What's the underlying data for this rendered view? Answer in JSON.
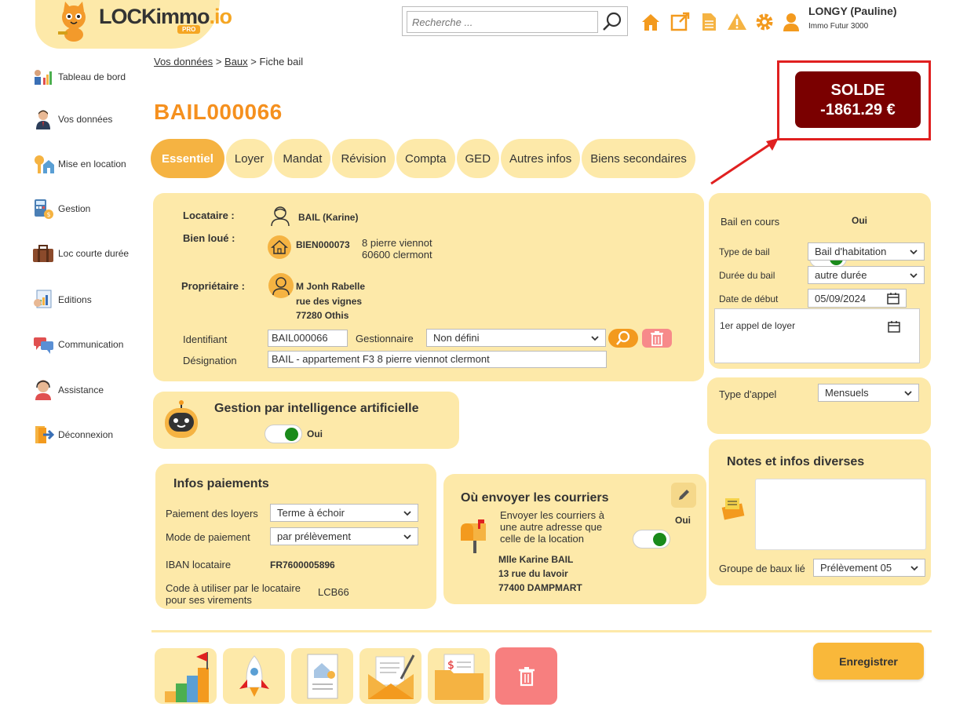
{
  "logo": {
    "name_main": "LOCKimmo",
    "name_suffix": ".io",
    "badge": "PRO"
  },
  "search": {
    "placeholder": "Recherche ..."
  },
  "user": {
    "name": "LONGY (Pauline)",
    "company": "Immo Futur 3000"
  },
  "sidebar": {
    "items": [
      {
        "label": "Tableau de bord"
      },
      {
        "label": "Vos données"
      },
      {
        "label": "Mise en location"
      },
      {
        "label": "Gestion"
      },
      {
        "label": "Loc courte durée"
      },
      {
        "label": "Editions"
      },
      {
        "label": "Communication"
      },
      {
        "label": "Assistance"
      },
      {
        "label": "Déconnexion"
      }
    ]
  },
  "breadcrumb": {
    "item1": "Vos données",
    "item2": "Baux",
    "current": "Fiche bail",
    "sep": ">"
  },
  "page": {
    "title": "BAIL000066"
  },
  "solde": {
    "label": "SOLDE",
    "amount": "-1861.29 €"
  },
  "tabs": [
    "Essentiel",
    "Loyer",
    "Mandat",
    "Révision",
    "Compta",
    "GED",
    "Autres infos",
    "Biens secondaires"
  ],
  "main": {
    "locataire_label": "Locataire :",
    "locataire_value": "BAIL (Karine)",
    "bien_label": "Bien loué :",
    "bien_ref": "BIEN000073",
    "bien_addr1": "8 pierre viennot",
    "bien_addr2": "60600 clermont",
    "proprio_label": "Propriétaire :",
    "proprio_name": "M Jonh Rabelle",
    "proprio_addr1": "rue des vignes",
    "proprio_addr2": "77280 Othis",
    "identifiant_label": "Identifiant",
    "identifiant_value": "BAIL000066",
    "gestionnaire_label": "Gestionnaire",
    "gestionnaire_value": "Non défini",
    "designation_label": "Désignation",
    "designation_value": "BAIL - appartement F3 8 pierre viennot clermont"
  },
  "ai": {
    "title": "Gestion par intelligence artificielle",
    "toggle_label": "Oui"
  },
  "paiements": {
    "title": "Infos paiements",
    "paiement_label": "Paiement des loyers",
    "paiement_value": "Terme à échoir",
    "mode_label": "Mode de paiement",
    "mode_value": "par prélèvement",
    "iban_label": "IBAN locataire",
    "iban_value": "FR7600005896",
    "code_label_1": "Code à utiliser par le locataire",
    "code_label_2": "pour ses virements",
    "code_value": "LCB66"
  },
  "courriers": {
    "title": "Où envoyer les courriers",
    "desc_1": "Envoyer les courriers à",
    "desc_2": "une autre adresse que",
    "desc_3": "celle de la location",
    "toggle_label": "Oui",
    "addr_name": "Mlle Karine BAIL",
    "addr_1": "13 rue du lavoir",
    "addr_2": "77400 DAMPMART"
  },
  "bail": {
    "en_cours_label": "Bail en cours",
    "en_cours_toggle": "Oui",
    "type_label": "Type de bail",
    "type_value": "Bail d'habitation",
    "duree_label": "Durée du bail",
    "duree_value": "autre durée",
    "debut_label": "Date de début",
    "debut_value": "05/09/2024",
    "appel_label": "1er appel de loyer"
  },
  "appel": {
    "label": "Type d'appel",
    "value": "Mensuels"
  },
  "notes": {
    "title": "Notes et infos diverses",
    "groupe_label": "Groupe de baux lié",
    "groupe_value": "Prélèvement 05"
  },
  "actions": {
    "save_label": "Enregistrer"
  },
  "colors": {
    "accent": "#f5901e",
    "panel": "#fde9a9",
    "solde_bg": "#7a0000",
    "highlight": "#e02020",
    "toggle_on": "#1a8a1a"
  }
}
